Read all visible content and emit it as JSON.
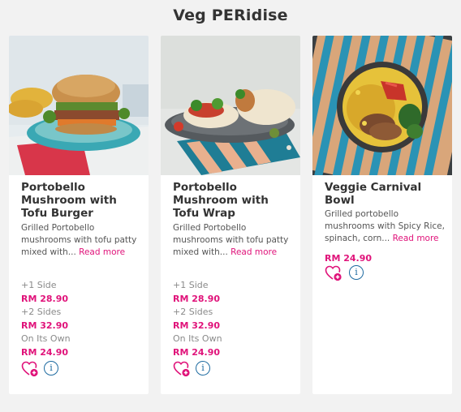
{
  "page": {
    "title": "Veg PERidise"
  },
  "cards": [
    {
      "name": "Portobello Mushroom with Tofu Burger",
      "desc": "Grilled Portobello mushrooms with tofu patty mixed with... ",
      "read_more": "Read more",
      "options": [
        {
          "label": "+1 Side",
          "price": "RM 28.90"
        },
        {
          "label": "+2 Sides",
          "price": "RM 32.90"
        },
        {
          "label": "On Its Own",
          "price": "RM 24.90"
        }
      ],
      "info_glyph": "i"
    },
    {
      "name": "Portobello Mushroom with Tofu Wrap",
      "desc": "Grilled Portobello mushrooms with tofu patty mixed with... ",
      "read_more": "Read more",
      "options": [
        {
          "label": "+1 Side",
          "price": "RM 28.90"
        },
        {
          "label": "+2 Sides",
          "price": "RM 32.90"
        },
        {
          "label": "On Its Own",
          "price": "RM 24.90"
        }
      ],
      "info_glyph": "i"
    },
    {
      "name": "Veggie Carnival Bowl",
      "desc": "Grilled portobello mushrooms with Spicy Rice, spinach, corn... ",
      "read_more": "Read more",
      "price": "RM 24.90",
      "info_glyph": "i"
    }
  ],
  "icons": {
    "favorite": "heart-plus-icon",
    "info": "info-icon"
  },
  "colors": {
    "price": "#e0137a",
    "info": "#1d6aa0",
    "background": "#f2f2f2"
  }
}
